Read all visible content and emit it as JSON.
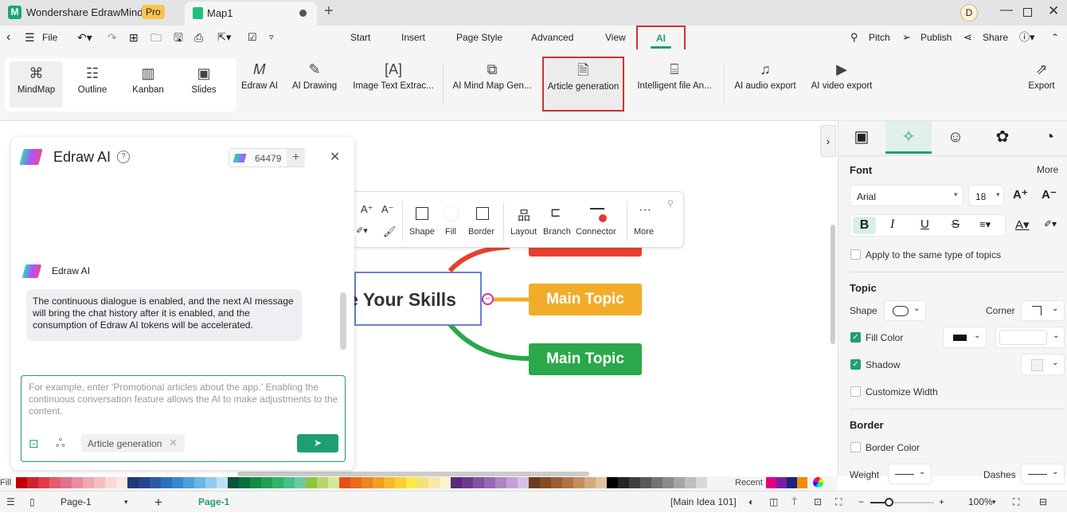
{
  "app": {
    "name": "Wondershare EdrawMind",
    "badge": "Pro",
    "doc_tab": "Map1",
    "avatar": "D"
  },
  "menu": {
    "file": "File",
    "tabs": [
      "Start",
      "Insert",
      "Page Style",
      "Advanced",
      "View",
      "AI"
    ],
    "active_tab": "AI",
    "right": [
      "Pitch",
      "Publish",
      "Share"
    ]
  },
  "ribbon": {
    "views": [
      "MindMap",
      "Outline",
      "Kanban",
      "Slides"
    ],
    "active_view": "MindMap",
    "tools": [
      "Edraw AI",
      "AI Drawing",
      "Image Text Extrac...",
      "AI Mind Map Gen...",
      "Article generation",
      "Intelligent file An...",
      "AI audio export",
      "AI video export"
    ],
    "highlighted_tool": "Article generation",
    "export": "Export"
  },
  "chat": {
    "title": "Edraw AI",
    "tokens": "64479",
    "sender": "Edraw AI",
    "message": "The continuous dialogue is enabled, and the next AI message will bring the chat history after it is enabled, and the consumption of Edraw AI tokens will be accelerated.",
    "placeholder": "For example, enter 'Promotional articles about the app.' Enabling the continuous conversation feature allows the AI to make adjustments to the content.",
    "chip": "Article generation"
  },
  "canvas": {
    "central": "e Your Skills",
    "topics": [
      {
        "label": "Main Topic",
        "color": "#f2ac2a"
      },
      {
        "label": "Main Topic",
        "color": "#2aa84a"
      }
    ],
    "hidden_topic_color": "#e8402e"
  },
  "floatbar": {
    "items": [
      "Shape",
      "Fill",
      "Border",
      "Layout",
      "Branch",
      "Connector",
      "More"
    ]
  },
  "panel": {
    "font_head": "Font",
    "more": "More",
    "font": "Arial",
    "size": "18",
    "apply_same": "Apply to the same type of topics",
    "topic_head": "Topic",
    "shape": "Shape",
    "corner": "Corner",
    "fill_color": "Fill Color",
    "fill_checked": true,
    "shadow": "Shadow",
    "shadow_checked": true,
    "custom_width": "Customize Width",
    "border_head": "Border",
    "border_color": "Border Color",
    "weight": "Weight",
    "dashes": "Dashes"
  },
  "palette": {
    "label": "Fill",
    "recent": "Recent",
    "colors": [
      "#c00000",
      "#d2222d",
      "#e03a4a",
      "#e85a6a",
      "#e07090",
      "#ee8aa0",
      "#f0a8b0",
      "#f4c0c0",
      "#f8d8d8",
      "#fbe8e8",
      "#1f3a78",
      "#26448e",
      "#2a5aa8",
      "#2f6fc0",
      "#3a86d0",
      "#4aa0dc",
      "#6ab6e4",
      "#92cbee",
      "#bfe0f4",
      "#06543a",
      "#0a6e3e",
      "#138a48",
      "#1ea055",
      "#2fb46a",
      "#44c088",
      "#6dcaa0",
      "#8ec63f",
      "#b4d86a",
      "#d4e89a",
      "#e65016",
      "#ec6a1a",
      "#f0841e",
      "#f49e22",
      "#f8b82a",
      "#fad030",
      "#fce84a",
      "#f8e07a",
      "#fae8a8",
      "#fcf2d0",
      "#5a2a78",
      "#6e3a8e",
      "#8450a2",
      "#9a68b4",
      "#b084c4",
      "#c4a0d4",
      "#d8c0e4",
      "#6e3a1e",
      "#844a26",
      "#9a5e32",
      "#b07444",
      "#c48e5e",
      "#d4aa80",
      "#e0c4a4",
      "#000000",
      "#262626",
      "#404040",
      "#595959",
      "#737373",
      "#8c8c8c",
      "#a6a6a6",
      "#bfbfbf",
      "#d9d9d9"
    ],
    "recent_colors": [
      "#e6007e",
      "#7a1fa2",
      "#1a237e",
      "#f28c00"
    ]
  },
  "status": {
    "page_select": "Page-1",
    "page_tab": "Page-1",
    "selection": "[Main Idea 101]",
    "zoom": "100%",
    "zoom_level": 100
  }
}
